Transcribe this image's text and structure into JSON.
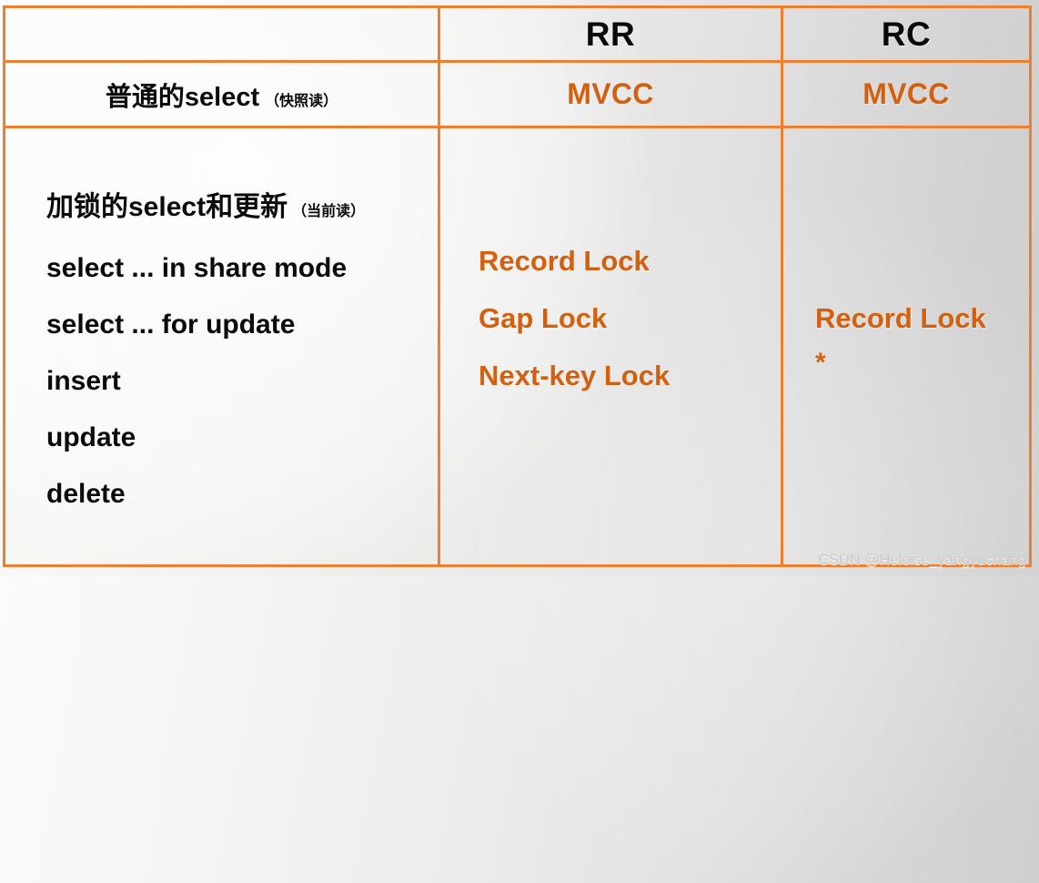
{
  "theme": {
    "border_color": "#ED8030",
    "accent_color": "#D2600E",
    "text_color": "#0A0A0A",
    "watermark_color": "#C9C9C9"
  },
  "table": {
    "corner_label": "",
    "columns": [
      {
        "key": "rr",
        "label": "RR"
      },
      {
        "key": "rc",
        "label": "RC"
      }
    ],
    "rows": [
      {
        "key": "plain-select",
        "label_main": "普通的select",
        "label_paren": "（快照读）",
        "rr": "MVCC",
        "rc": "MVCC"
      },
      {
        "key": "locking-select",
        "label_main": "加锁的select和更新",
        "label_paren": "（当前读）",
        "operations": [
          "select ... in share mode",
          "select ... for update",
          "insert",
          "update",
          "delete"
        ],
        "rr_locks": [
          "Record Lock",
          "Gap Lock",
          "Next-key Lock"
        ],
        "rc_locks": [
          "Record Lock",
          "*"
        ]
      }
    ]
  },
  "watermark": {
    "text": "CSDN @Heloise_yangyuchang"
  }
}
